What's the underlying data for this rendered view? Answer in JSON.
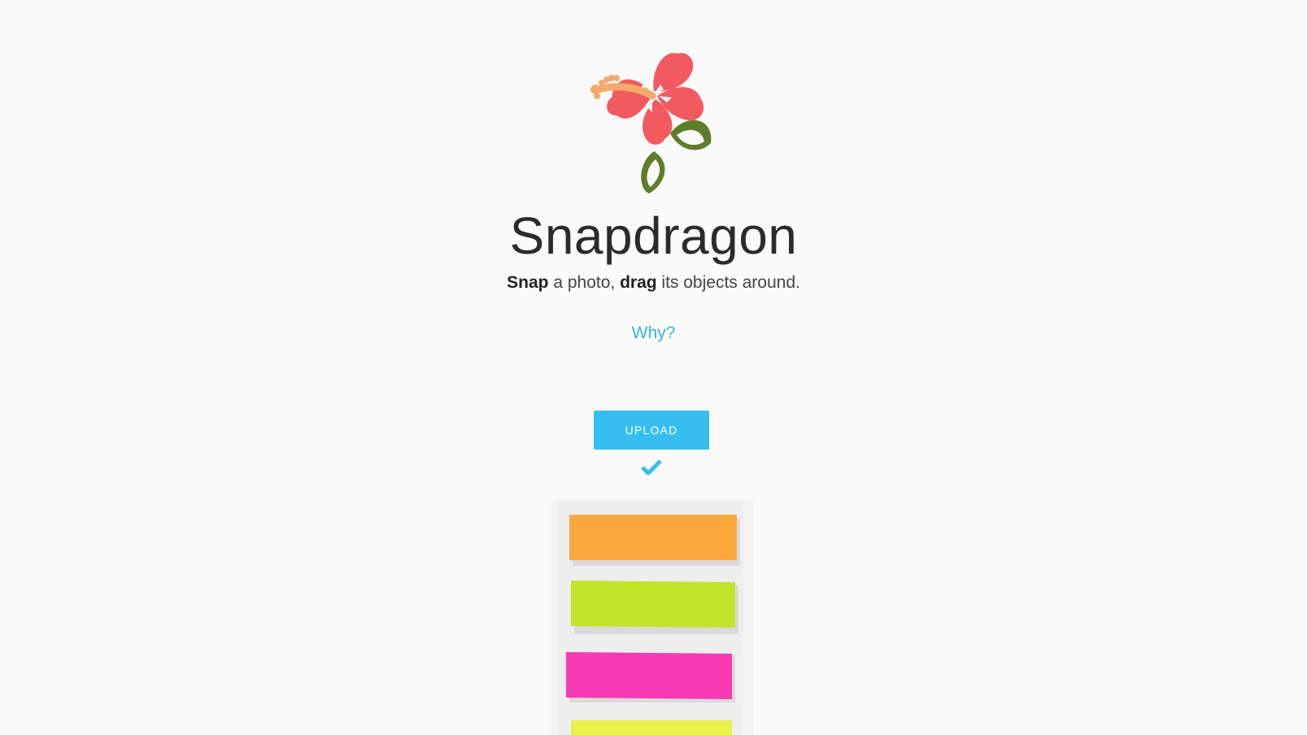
{
  "app": {
    "title": "Snapdragon",
    "tagline_parts": {
      "snap": "Snap",
      "middle": " a photo, ",
      "drag": "drag",
      "end": " its objects around."
    },
    "why_link": "Why?",
    "upload_label": "UPLOAD"
  },
  "icons": {
    "logo": "hibiscus-flower-icon",
    "status": "checkmark-icon"
  },
  "colors": {
    "accent": "#36bfee",
    "link": "#35b5e0",
    "petal": "#f15a5f",
    "stamen": "#f7a96b",
    "leaf": "#5f7d2a",
    "background": "#fafafa",
    "note_orange": "#fda83c",
    "note_green": "#c3e22a",
    "note_pink": "#f53ab4",
    "note_yellow": "#e9f04a"
  }
}
